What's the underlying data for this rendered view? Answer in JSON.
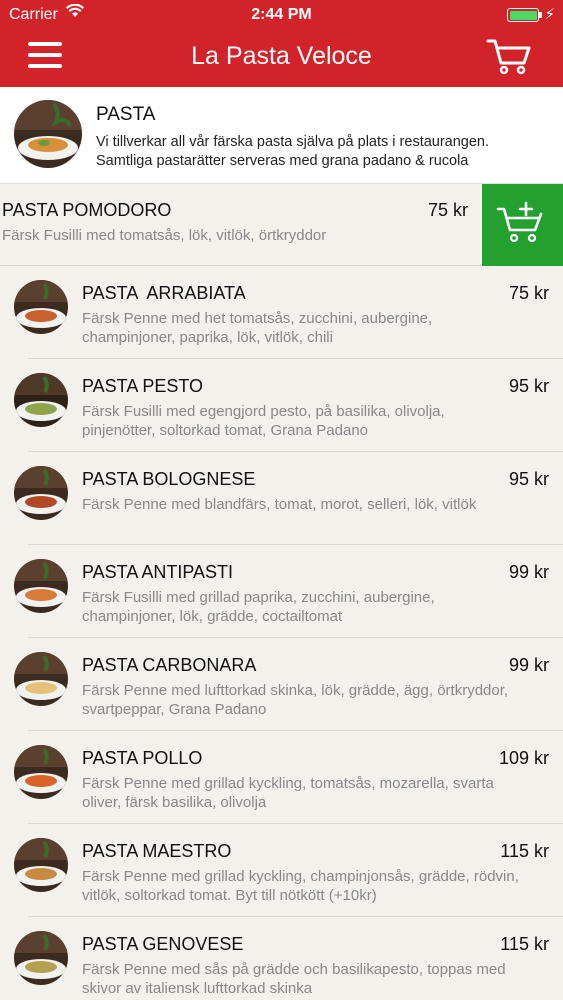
{
  "status_bar": {
    "carrier": "Carrier",
    "time": "2:44 PM",
    "battery_color": "#4cd964"
  },
  "nav": {
    "title": "La Pasta Veloce",
    "left_icon": "hamburger-menu-icon",
    "right_icon": "shopping-cart-icon",
    "background": "#d2232a"
  },
  "category": {
    "title": "PASTA",
    "description_line1": "Vi tillverkar all vår färska pasta själva på plats i restaurangen.",
    "description_line2": "Samtliga pastarätter serveras med grana padano & rucola"
  },
  "featured": {
    "name": "PASTA POMODORO",
    "price": "75 kr",
    "description": "Färsk Fusilli med tomatsås, lök, vitlök, örtkryddor",
    "add_icon": "add-to-cart-icon",
    "add_color": "#24a031"
  },
  "items": [
    {
      "name": "PASTA  ARRABIATA",
      "price": "75 kr",
      "description": "Färsk Penne med het tomatsås, zucchini, aubergine, champinjoner, paprika, lök, vitlök, chili"
    },
    {
      "name": "PASTA PESTO",
      "price": "95 kr",
      "description": "Färsk Fusilli med egengjord pesto, på basilika, olivolja, pinjenötter, soltorkad tomat, Grana Padano"
    },
    {
      "name": "PASTA BOLOGNESE",
      "price": "95 kr",
      "description": "Färsk Penne med blandfärs, tomat, morot, selleri, lök, vitlök"
    },
    {
      "name": "PASTA ANTIPASTI",
      "price": "99 kr",
      "description": "Färsk Fusilli med grillad paprika, zucchini, aubergine, champinjoner, lök, grädde, coctailtomat"
    },
    {
      "name": "PASTA CARBONARA",
      "price": "99 kr",
      "description": "Färsk Penne med lufttorkad skinka, lök, grädde, ägg, örtkryddor, svartpeppar, Grana Padano"
    },
    {
      "name": "PASTA POLLO",
      "price": "109 kr",
      "description": "Färsk Penne med grillad kyckling, tomatsås, mozarella, svarta oliver, färsk basilika, olivolja"
    },
    {
      "name": "PASTA MAESTRO",
      "price": "115 kr",
      "description": "Färsk Penne med grillad kyckling, champinjonsås, grädde, rödvin, vitlök, soltorkad tomat. Byt till nötkött (+10kr)"
    },
    {
      "name": "PASTA GENOVESE",
      "price": "115 kr",
      "description": "Färsk Penne med sås på grädde och basilikapesto, toppas med skivor av italiensk lufttorkad skinka"
    }
  ]
}
